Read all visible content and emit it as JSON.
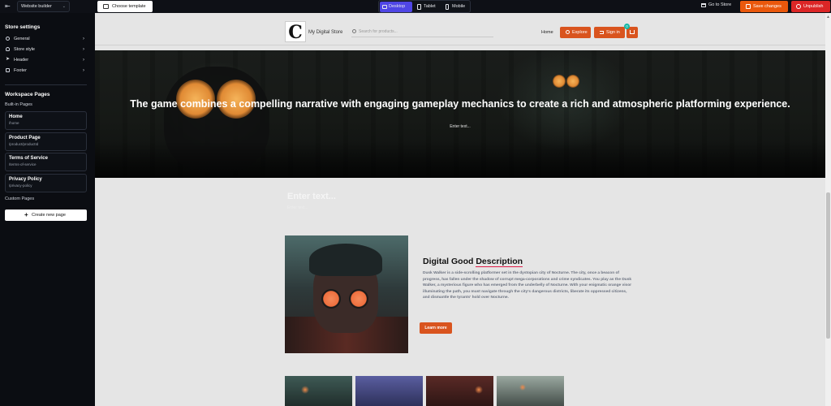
{
  "topbar": {
    "builder_select": "Website builder",
    "choose_template": "Choose template",
    "devices": [
      "Desktop",
      "Tablet",
      "Mobile"
    ],
    "active_device": "Desktop",
    "go_to_store": "Go to Store",
    "save_changes": "Save changes",
    "unpublish": "Unpublish"
  },
  "sidebar": {
    "store_settings_title": "Store settings",
    "settings_items": [
      {
        "label": "General",
        "icon": "gear-icon"
      },
      {
        "label": "Store style",
        "icon": "palette-icon"
      },
      {
        "label": "Header",
        "icon": "send-icon"
      },
      {
        "label": "Footer",
        "icon": "footer-icon"
      }
    ],
    "workspace_title": "Workspace Pages",
    "built_in_label": "Built-in Pages",
    "pages": [
      {
        "title": "Home",
        "path": "/home"
      },
      {
        "title": "Product Page",
        "path": "/product/productId"
      },
      {
        "title": "Terms of Service",
        "path": "/terms-of-service"
      },
      {
        "title": "Privacy Policy",
        "path": "/privacy-policy"
      }
    ],
    "custom_label": "Custom Pages",
    "create_page": "Create new page"
  },
  "store": {
    "logo_letter": "C",
    "name": "My Digital Store",
    "search_placeholder": "Search for products...",
    "nav_home": "Home",
    "explore": "Explore",
    "sign_in": "Sign in",
    "cart_count": "0"
  },
  "hero": {
    "heading": "The game combines a compelling narrative with engaging gameplay mechanics to create a rich and atmospheric platforming experience.",
    "sub": "Enter text..."
  },
  "section": {
    "title": "Enter text...",
    "sub": "Enter text..."
  },
  "product": {
    "title_plain": "Digital Good ",
    "title_underlined": "Description",
    "body": "Dusk Walker is a side-scrolling platformer set in the dystopian city of Nocturne. The city, once a beacon of progress, has fallen under the shadow of corrupt mega-corporations and crime syndicates. You play as the Dusk Walker, a mysterious figure who has emerged from the underbelly of Nocturne. With your enigmatic orange visor illuminating the path, you must navigate through the city's dangerous districts, liberate its oppressed citizens, and dismantle the tyrants' hold over Nocturne.",
    "learn_more": "Learn more"
  },
  "colors": {
    "accent_orange": "#d9541e",
    "save_orange": "#ea580c",
    "unpublish_red": "#dc2626",
    "device_active": "#4f46e5"
  }
}
